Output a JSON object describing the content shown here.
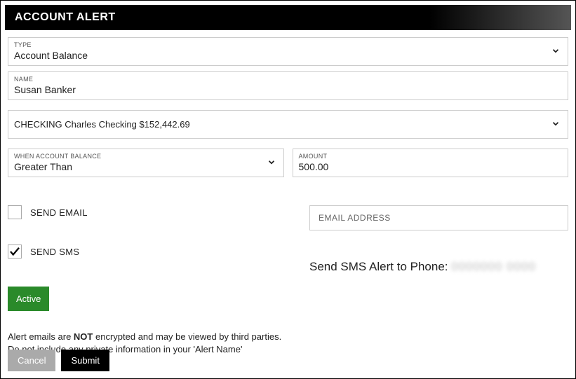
{
  "header": {
    "title": "ACCOUNT ALERT"
  },
  "fields": {
    "type": {
      "label": "TYPE",
      "value": "Account Balance"
    },
    "name": {
      "label": "NAME",
      "value": "Susan Banker"
    },
    "account": {
      "value": "CHECKING Charles Checking $152,442.69"
    },
    "condition": {
      "label": "WHEN ACCOUNT BALANCE",
      "value": "Greater Than"
    },
    "amount": {
      "label": "AMOUNT",
      "value": "500.00"
    }
  },
  "notifications": {
    "send_email_label": "SEND EMAIL",
    "send_sms_label": "SEND SMS",
    "email_placeholder": "EMAIL ADDRESS",
    "sms_text_prefix": "Send SMS Alert to Phone: ",
    "sms_phone_masked": "0000000 0000"
  },
  "buttons": {
    "active": "Active",
    "cancel": "Cancel",
    "submit": "Submit"
  },
  "disclaimer": {
    "line1_pre": "Alert emails are ",
    "line1_bold": "NOT",
    "line1_post": " encrypted and may be viewed by third parties.",
    "line2": "Do not include any private information in your 'Alert Name'"
  }
}
